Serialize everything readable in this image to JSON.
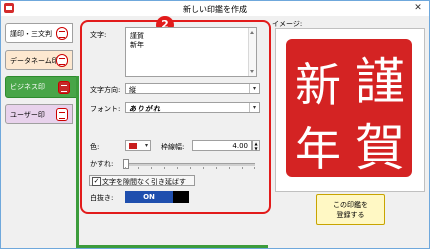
{
  "window": {
    "title": "新しい印鑑を作成",
    "close_glyph": "✕"
  },
  "tabs": [
    {
      "label": "謹印・三文判",
      "active": false
    },
    {
      "label": "データネーム印",
      "active": false
    },
    {
      "label": "ビジネス印",
      "active": true
    },
    {
      "label": "ユーザー印",
      "active": false
    }
  ],
  "step_badge": "2",
  "form": {
    "text_label": "文字:",
    "text_lines": [
      "謹賀",
      "新年"
    ],
    "direction_label": "文字方向:",
    "direction_value": "縦",
    "font_label": "フォント:",
    "font_value": "ありがれ",
    "color_label": "色:",
    "color_value": "#c81e1e",
    "border_label": "枠線幅:",
    "border_value": "4.00",
    "blur_label": "かすれ:",
    "blur_level": 0,
    "stretch_checkbox_label": "文字を隙間なく引き延ばす",
    "stretch_checked": true,
    "check_glyph": "✓",
    "invert_label": "白抜き:",
    "invert_value": "ON",
    "dropdown_glyph": "▾"
  },
  "preview": {
    "label": "イメージ:",
    "seal_chars": [
      "謹",
      "新",
      "賀",
      "年"
    ],
    "seal_color": "#d42323"
  },
  "register_button": {
    "line1": "この印鑑を",
    "line2": "登録する"
  }
}
